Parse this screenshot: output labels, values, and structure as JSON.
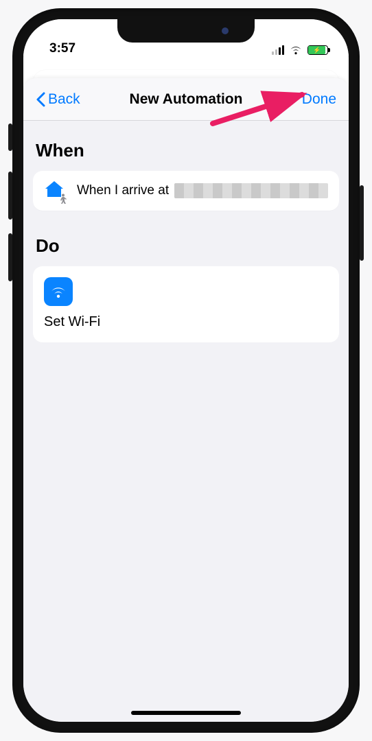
{
  "status": {
    "time": "3:57"
  },
  "nav": {
    "back": "Back",
    "title": "New Automation",
    "done": "Done"
  },
  "sections": {
    "when": {
      "heading": "When",
      "condition_prefix": "When I arrive at"
    },
    "do": {
      "heading": "Do",
      "action_label": "Set Wi-Fi"
    }
  }
}
